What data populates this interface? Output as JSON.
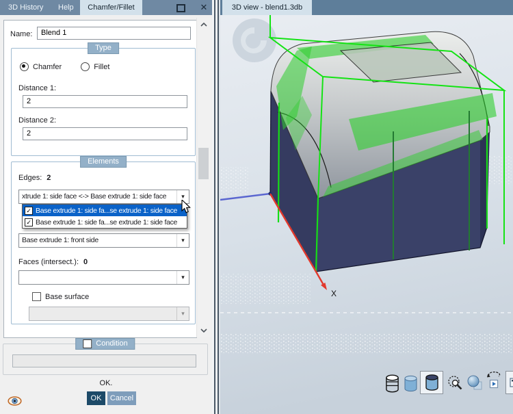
{
  "window": {
    "left_tabs": [
      {
        "label": "3D History"
      },
      {
        "label": "Help"
      },
      {
        "label": "Chamfer/Fillet",
        "active": true
      }
    ]
  },
  "dialog": {
    "name_label": "Name:",
    "name_value": "Blend 1",
    "type_group": {
      "title": "Type",
      "options": [
        {
          "label": "Chamfer",
          "selected": true
        },
        {
          "label": "Fillet",
          "selected": false
        }
      ],
      "distance1_label": "Distance 1:",
      "distance1_value": "2",
      "distance2_label": "Distance 2:",
      "distance2_value": "2"
    },
    "elements_group": {
      "title": "Elements",
      "edges_label": "Edges:",
      "edges_count": "2",
      "edge_combo_value": "xtrude 1: side face <-> Base extrude 1: side face",
      "edge_dropdown": [
        {
          "label": "Base extrude 1: side fa...se extrude 1: side face",
          "checked": true,
          "highlighted": true
        },
        {
          "label": "Base extrude 1: side fa...se extrude 1: side face",
          "checked": true,
          "highlighted": false
        }
      ],
      "face_combo_value": "Base extrude 1: front side",
      "faces_label": "Faces (intersect.):",
      "faces_count": "0",
      "faces_combo_value": "",
      "base_surface_label": "Base surface",
      "base_surface_checked": false,
      "base_surface_combo_value": ""
    },
    "condition_group": {
      "title": "Condition",
      "checked": false,
      "value": ""
    },
    "status_text": "OK.",
    "ok_label": "OK",
    "cancel_label": "Cancel"
  },
  "viewport": {
    "tab_label": "3D view - blend1.3db",
    "axis_x_label": "X"
  },
  "icons": {
    "check": "✓",
    "dropdown_arrow": "▾",
    "close": "✕"
  },
  "colors": {
    "tabbar": "#6f89a3",
    "active_tab": "#d3e1eb",
    "group_chip": "#93b0c8",
    "highlight_row": "#0a62c8",
    "ok_button": "#1d4a68",
    "cancel_button": "#7e9dbb",
    "solid_navy": "#3a4168",
    "preview_green": "#2fce2f",
    "wireframe_green": "#14e314",
    "axis_x": "#e2382c",
    "axis_blue": "#5a66d0"
  }
}
